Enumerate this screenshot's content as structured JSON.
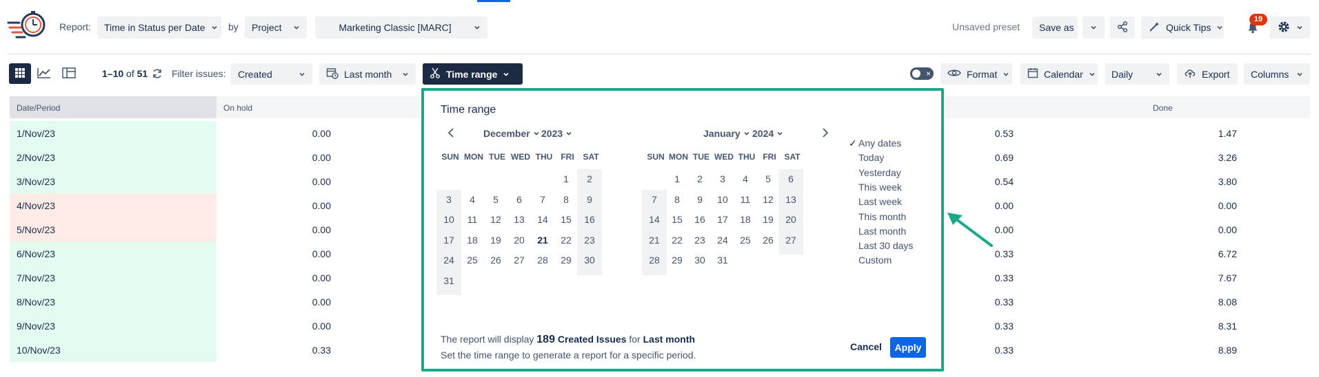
{
  "colors": {
    "accent": "#0c66e4",
    "dark": "#1d2a44",
    "highlight_border": "#1aa88a",
    "row_green": "#e3fcef",
    "row_red": "#ffebe6",
    "badge": "#de350b"
  },
  "header": {
    "report_label": "Report:",
    "report_value": "Time in Status per Date",
    "by_label": "by",
    "group_value": "Project",
    "project_value": "Marketing Classic [MARC]",
    "preset_status": "Unsaved preset",
    "save_as": "Save as",
    "quick_tips": "Quick Tips",
    "notification_count": "19",
    "icons": [
      "logo-icon",
      "share-icon",
      "magic-wand-icon",
      "bell-icon",
      "gear-icon"
    ]
  },
  "toolbar": {
    "count_range": "1–10",
    "count_of": "of",
    "count_total": "51",
    "filter_label": "Filter issues:",
    "filter_value": "Created",
    "period_value": "Last month",
    "time_range": "Time range",
    "format": "Format",
    "calendar": "Calendar",
    "granularity": "Daily",
    "export": "Export",
    "columns": "Columns"
  },
  "table": {
    "headers": [
      "Date/Period",
      "On hold",
      "Done"
    ],
    "rows": [
      {
        "date": "1/Nov/23",
        "on_hold": "0.00",
        "col_hidden": "0.53",
        "done": "1.47",
        "status": "green"
      },
      {
        "date": "2/Nov/23",
        "on_hold": "0.00",
        "col_hidden": "0.69",
        "done": "3.26",
        "status": "green"
      },
      {
        "date": "3/Nov/23",
        "on_hold": "0.00",
        "col_hidden": "0.54",
        "done": "3.80",
        "status": "green"
      },
      {
        "date": "4/Nov/23",
        "on_hold": "0.00",
        "col_hidden": "0.00",
        "done": "0.00",
        "status": "red"
      },
      {
        "date": "5/Nov/23",
        "on_hold": "0.00",
        "col_hidden": "0.00",
        "done": "0.00",
        "status": "red"
      },
      {
        "date": "6/Nov/23",
        "on_hold": "0.00",
        "col_hidden": "0.33",
        "done": "6.72",
        "status": "green"
      },
      {
        "date": "7/Nov/23",
        "on_hold": "0.00",
        "col_hidden": "0.33",
        "done": "7.67",
        "status": "green"
      },
      {
        "date": "8/Nov/23",
        "on_hold": "0.00",
        "col_hidden": "0.33",
        "done": "8.08",
        "status": "green"
      },
      {
        "date": "9/Nov/23",
        "on_hold": "0.00",
        "col_hidden": "0.33",
        "done": "8.31",
        "status": "green"
      },
      {
        "date": "10/Nov/23",
        "on_hold": "0.33",
        "col_hidden": "0.33",
        "done": "8.89",
        "status": "green"
      }
    ]
  },
  "time_range_popup": {
    "title": "Time range",
    "weekdays": [
      "SUN",
      "MON",
      "TUE",
      "WED",
      "THU",
      "FRI",
      "SAT"
    ],
    "left_month": {
      "month": "December",
      "year": "2023",
      "first_weekday": 5,
      "days": 31,
      "bold_day": 21
    },
    "right_month": {
      "month": "January",
      "year": "2024",
      "first_weekday": 1,
      "days": 31
    },
    "quick_options": [
      "Any dates",
      "Today",
      "Yesterday",
      "This week",
      "Last week",
      "This month",
      "Last month",
      "Last 30 days",
      "Custom"
    ],
    "selected_option": "Any dates",
    "summary_prefix": "The report will display",
    "summary_count": "189",
    "summary_entity": "Created Issues",
    "summary_for": "for",
    "summary_period": "Last month",
    "hint": "Set the time range to generate a report for a specific period.",
    "cancel": "Cancel",
    "apply": "Apply"
  }
}
